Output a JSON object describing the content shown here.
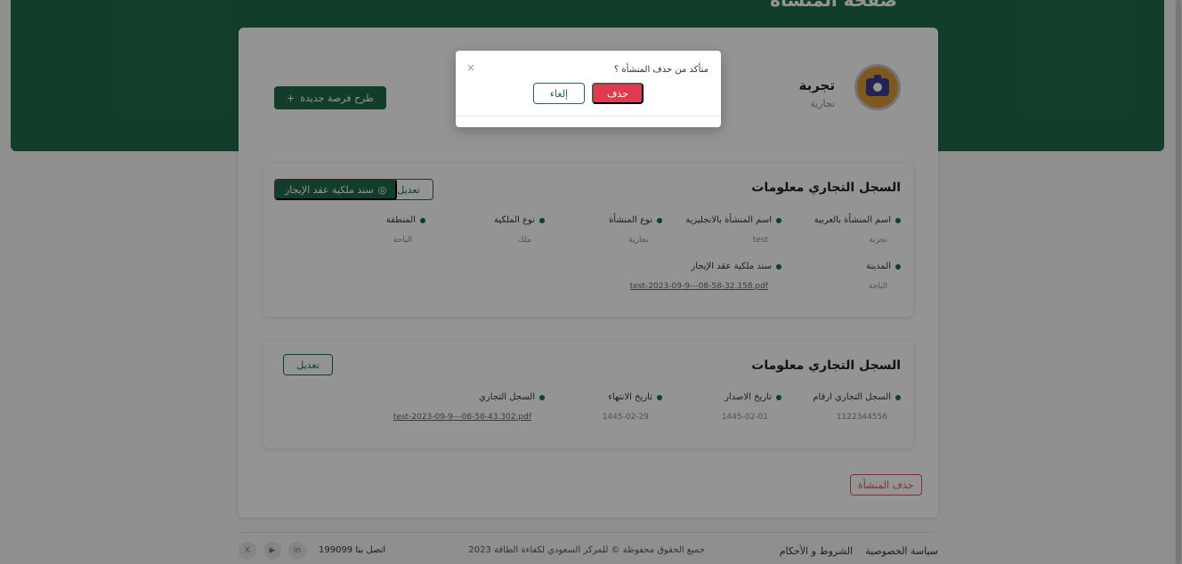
{
  "hero": {
    "title": "صفحة المنشأة"
  },
  "org": {
    "name": "تجربة",
    "type": "تجارية"
  },
  "actions": {
    "new_opportunity": "طرح فرصة جديدة",
    "new_opportunity_icon": "+",
    "edit": "تعديل",
    "deed_button": "سند ملكية عقد الإيجار",
    "delete_org": "حذف المنشأة"
  },
  "commercial_record": {
    "title": "السجل التجاري معلومات",
    "fields": [
      {
        "label": "اسم المنشأة بالعربية",
        "value": "تجربة"
      },
      {
        "label": "اسم المنشأة بالانجليزية",
        "value": "test"
      },
      {
        "label": "نوع المنشأة",
        "value": "تجارية"
      },
      {
        "label": "نوع الملكية",
        "value": "ملك"
      },
      {
        "label": "المنطقة",
        "value": "الباحة"
      },
      {
        "label": "المدينة",
        "value": "الباحة"
      },
      {
        "label": "سند ملكية عقد الإيجار",
        "value": "test-2023-09-9---08-58-32.158.pdf"
      }
    ]
  },
  "record_numbers": {
    "title": "السجل التجاري معلومات",
    "fields": [
      {
        "label": "السجل التجاري ارقام",
        "value": "1122344556"
      },
      {
        "label": "تاريخ الاصدار",
        "value": "1445-02-01"
      },
      {
        "label": "تاريخ الانتهاء",
        "value": "1445-02-29"
      },
      {
        "label": "السجل التجاري",
        "value": "test-2023-09-9---08-58-43.302.pdf"
      }
    ]
  },
  "footer": {
    "privacy": "سياسة الخصوصية",
    "terms": "الشروط و الأحكام",
    "copyright": "جميع الحقوق محفوظة © للمركز السعودي لكفاءة الطاقة 2023",
    "contact": "اتصل بنا 199099",
    "socials": [
      "in",
      "▶",
      "X"
    ]
  },
  "modal": {
    "message": "متأكد من حذف المنشأة ؟",
    "delete": "حذف",
    "cancel": "إلغاء",
    "close": "×"
  },
  "colors": {
    "primary": "#1f6a4a",
    "danger": "#e03a4e"
  }
}
